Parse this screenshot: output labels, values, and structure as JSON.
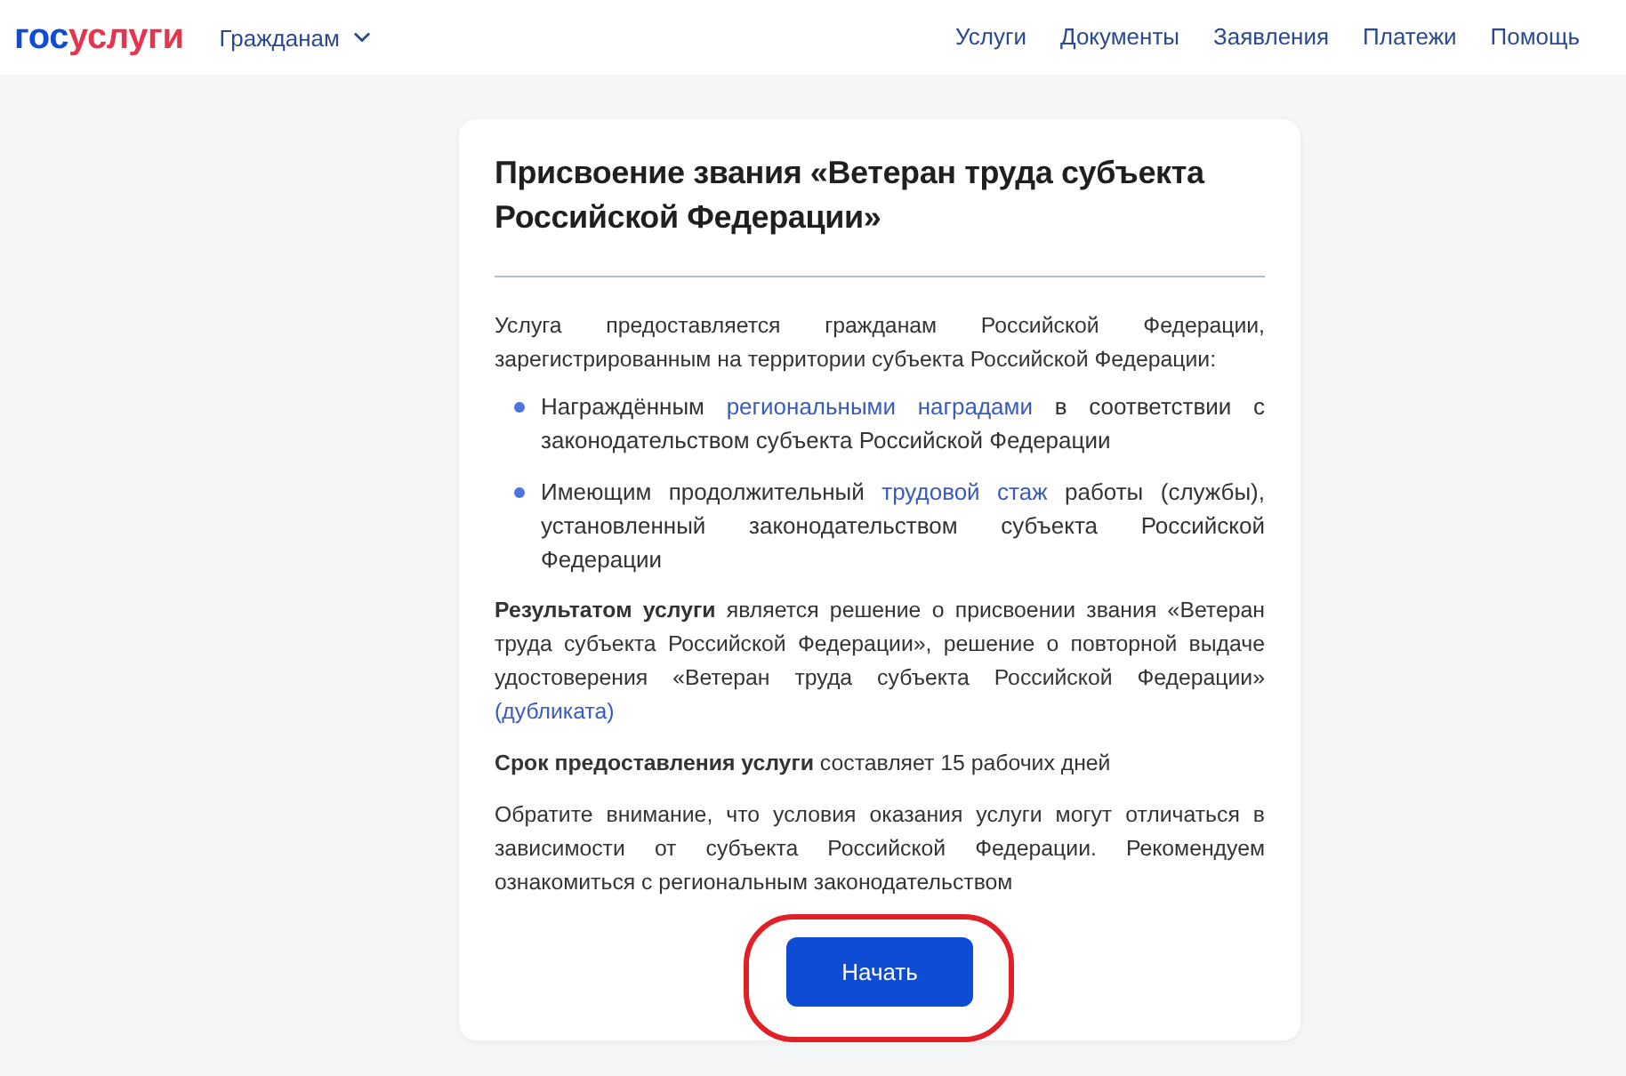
{
  "header": {
    "logo": [
      {
        "text": "гос",
        "color": "#0d4cd3"
      },
      {
        "text": "услуги",
        "color": "#e4344e"
      }
    ],
    "menu": {
      "label": "Гражданам"
    },
    "nav": [
      "Услуги",
      "Документы",
      "Заявления",
      "Платежи",
      "Помощь"
    ]
  },
  "card": {
    "title": "Присвоение звания «Ветеран труда субъекта Российской Федерации»",
    "blocks": [
      {
        "kind": "paragraph",
        "segments": [
          {
            "kind": "text",
            "text": "Услуга предоставляется гражданам Российской Федерации, зарегистрированным на территории субъекта Российской Федерации:"
          }
        ]
      },
      {
        "kind": "list",
        "items": [
          {
            "segments": [
              {
                "kind": "text",
                "text": "Награждённым "
              },
              {
                "kind": "link",
                "text": "региональными наградами"
              },
              {
                "kind": "text",
                "text": " в соответствии с законодательством субъекта Российской Федерации"
              }
            ]
          },
          {
            "segments": [
              {
                "kind": "text",
                "text": "Имеющим продолжительный "
              },
              {
                "kind": "link",
                "text": "трудовой стаж"
              },
              {
                "kind": "text",
                "text": " работы (службы), установленный законодательством субъекта Российской Федерации"
              }
            ]
          }
        ]
      },
      {
        "kind": "paragraph",
        "segments": [
          {
            "kind": "text",
            "text": "**Результатом услуги** является решение о присвоении звания «Ветеран труда субъекта Российской Федерации», решение о повторной выдаче удостоверения «Ветеран труда субъекта Российской Федерации» "
          },
          {
            "kind": "link",
            "text": "(дубликата)"
          }
        ]
      },
      {
        "kind": "paragraph",
        "segments": [
          {
            "kind": "text",
            "text": "**Срок предоставления услуги** составляет 15 рабочих дней"
          }
        ]
      },
      {
        "kind": "paragraph",
        "segments": [
          {
            "kind": "text",
            "text": "Обратите внимание, что условия оказания услуги могут отличаться в зависимости от субъекта Российской Федерации. Рекомендуем ознакомиться с региональным законодательством"
          }
        ]
      }
    ],
    "start_button": {
      "label": "Начать",
      "highlighted": true
    }
  }
}
